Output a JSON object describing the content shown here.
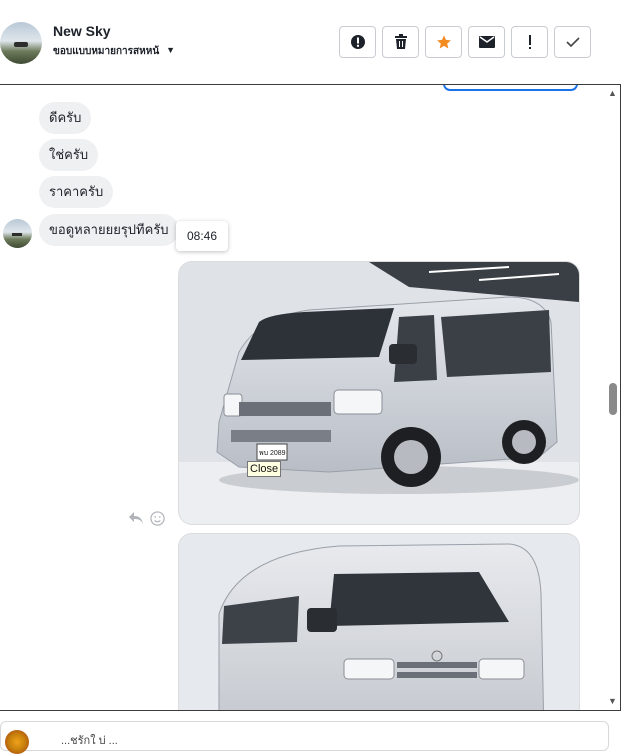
{
  "header": {
    "title": "New Sky",
    "subtitle": "ขอบแบบหมายการสหหน้",
    "actions": [
      {
        "name": "alert-circle-button",
        "icon": "alert-circle-icon"
      },
      {
        "name": "delete-button",
        "icon": "trash-icon"
      },
      {
        "name": "star-button",
        "icon": "star-icon"
      },
      {
        "name": "mail-button",
        "icon": "mail-icon"
      },
      {
        "name": "mark-important-button",
        "icon": "exclamation-icon"
      },
      {
        "name": "mark-done-button",
        "icon": "check-icon"
      }
    ],
    "accent_star": "#f28b20"
  },
  "messages": [
    {
      "text": "ดีครับ"
    },
    {
      "text": "ใช่ครับ"
    },
    {
      "text": "ราคาครับ"
    },
    {
      "text": "ขอดูหลายยยรุปทีครับ"
    }
  ],
  "timestamp_tooltip": "08:46",
  "photo_tooltip": "Close",
  "plate_text": "พบ 2089",
  "scrollbar": {
    "position": 0.5
  },
  "composer": {
    "text": "...ชรักใ  บ่ ..."
  }
}
